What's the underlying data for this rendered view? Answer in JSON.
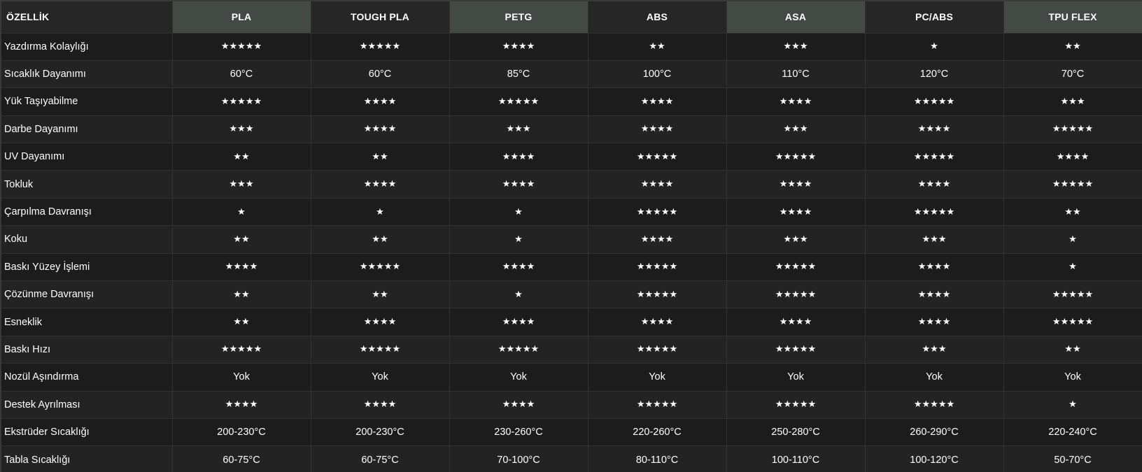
{
  "header": {
    "property_label": "ÖZELLİK",
    "materials": [
      "PLA",
      "TOUGH PLA",
      "PETG",
      "ABS",
      "ASA",
      "PC/ABS",
      "TPU FLEX"
    ],
    "highlighted_columns": [
      0,
      2,
      4,
      6
    ],
    "highlight_color": "#434a45"
  },
  "rows": [
    {
      "label": "Yazdırma Kolaylığı",
      "values": [
        "★★★★★",
        "★★★★★",
        "★★★★",
        "★★",
        "★★★",
        "★",
        "★★"
      ]
    },
    {
      "label": "Sıcaklık Dayanımı",
      "values": [
        "60°C",
        "60°C",
        "85°C",
        "100°C",
        "110°C",
        "120°C",
        "70°C"
      ]
    },
    {
      "label": "Yük Taşıyabilme",
      "values": [
        "★★★★★",
        "★★★★",
        "★★★★★",
        "★★★★",
        "★★★★",
        "★★★★★",
        "★★★"
      ]
    },
    {
      "label": "Darbe Dayanımı",
      "values": [
        "★★★",
        "★★★★",
        "★★★",
        "★★★★",
        "★★★",
        "★★★★",
        "★★★★★"
      ]
    },
    {
      "label": "UV Dayanımı",
      "values": [
        "★★",
        "★★",
        "★★★★",
        "★★★★★",
        "★★★★★",
        "★★★★★",
        "★★★★"
      ]
    },
    {
      "label": "Tokluk",
      "values": [
        "★★★",
        "★★★★",
        "★★★★",
        "★★★★",
        "★★★★",
        "★★★★",
        "★★★★★"
      ]
    },
    {
      "label": "Çarpılma Davranışı",
      "values": [
        "★",
        "★",
        "★",
        "★★★★★",
        "★★★★",
        "★★★★★",
        "★★"
      ]
    },
    {
      "label": "Koku",
      "values": [
        "★★",
        "★★",
        "★",
        "★★★★",
        "★★★",
        "★★★",
        "★"
      ]
    },
    {
      "label": "Baskı Yüzey İşlemi",
      "values": [
        "★★★★",
        "★★★★★",
        "★★★★",
        "★★★★★",
        "★★★★★",
        "★★★★",
        "★"
      ]
    },
    {
      "label": "Çözünme Davranışı",
      "values": [
        "★★",
        "★★",
        "★",
        "★★★★★",
        "★★★★★",
        "★★★★",
        "★★★★★"
      ]
    },
    {
      "label": "Esneklik",
      "values": [
        "★★",
        "★★★★",
        "★★★★",
        "★★★★",
        "★★★★",
        "★★★★",
        "★★★★★"
      ]
    },
    {
      "label": "Baskı Hızı",
      "values": [
        "★★★★★",
        "★★★★★",
        "★★★★★",
        "★★★★★",
        "★★★★★",
        "★★★",
        "★★"
      ]
    },
    {
      "label": "Nozül Aşındırma",
      "values": [
        "Yok",
        "Yok",
        "Yok",
        "Yok",
        "Yok",
        "Yok",
        "Yok"
      ]
    },
    {
      "label": "Destek Ayrılması",
      "values": [
        "★★★★",
        "★★★★",
        "★★★★",
        "★★★★★",
        "★★★★★",
        "★★★★★",
        "★"
      ]
    },
    {
      "label": "Ekstrüder Sıcaklığı",
      "values": [
        "200-230°C",
        "200-230°C",
        "230-260°C",
        "220-260°C",
        "250-280°C",
        "260-290°C",
        "220-240°C"
      ]
    },
    {
      "label": "Tabla Sıcaklığı",
      "values": [
        "60-75°C",
        "60-75°C",
        "70-100°C",
        "80-110°C",
        "100-110°C",
        "100-120°C",
        "50-70°C"
      ]
    }
  ]
}
